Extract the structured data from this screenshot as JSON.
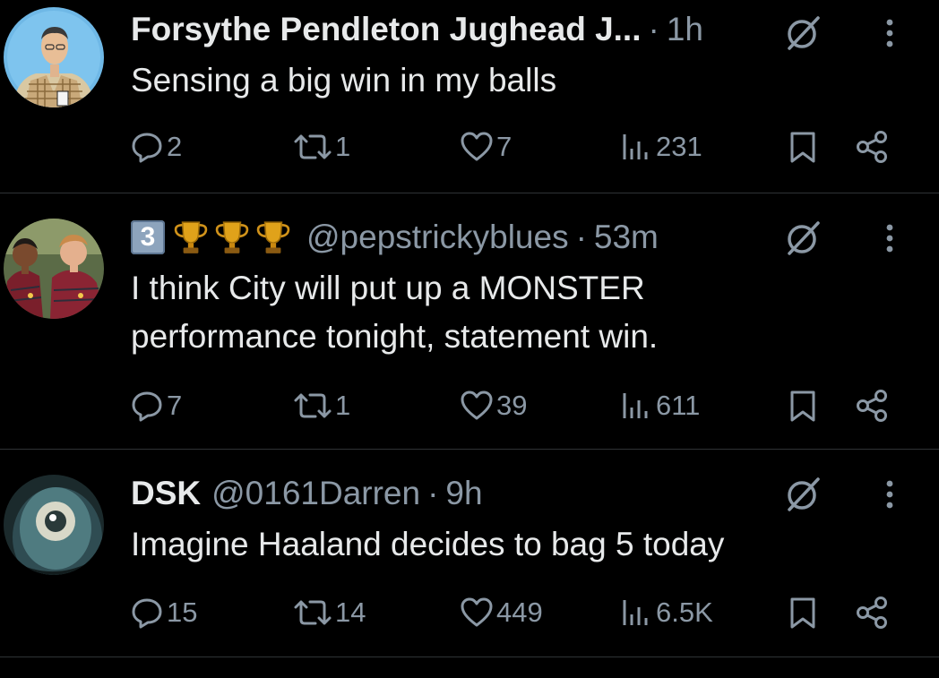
{
  "tweets": [
    {
      "name": "Forsythe Pendleton Jughead J...",
      "handle": "",
      "time": "1h",
      "text": "Sensing a big win in my balls",
      "replies": "2",
      "retweets": "1",
      "likes": "7",
      "views": "231"
    },
    {
      "name": "",
      "rank_badge": "3",
      "trophies": 3,
      "handle": "@pepstrickyblues",
      "time": "53m",
      "text": "I think City will put up a MONSTER\nperformance tonight, statement win.",
      "replies": "7",
      "retweets": "1",
      "likes": "39",
      "views": "611"
    },
    {
      "name": "DSK",
      "handle": "@0161Darren",
      "time": "9h",
      "text": "Imagine Haaland decides to bag 5 today",
      "replies": "15",
      "retweets": "14",
      "likes": "449",
      "views": "6.5K"
    }
  ],
  "separator": "·",
  "icons": {
    "reply": "reply-icon",
    "retweet": "retweet-icon",
    "like": "heart-icon",
    "views": "views-icon",
    "bookmark": "bookmark-icon",
    "share": "share-icon",
    "grok": "grok-icon",
    "more": "more-icon"
  },
  "colors": {
    "background": "#000000",
    "text": "#e7e9ea",
    "secondary": "#8b98a5",
    "divider": "#2f3336"
  }
}
